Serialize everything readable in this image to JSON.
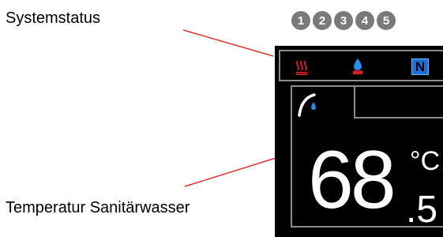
{
  "labels": {
    "system_status": "Systemstatus",
    "hot_water_temperature": "Temperatur Sanitärwasser"
  },
  "steps": [
    "1",
    "2",
    "3",
    "4",
    "5"
  ],
  "status_icons": [
    "heating-icon",
    "water-drop-flame-icon",
    "n-badge-icon"
  ],
  "status_badge": "N",
  "tab_icon": "tap-icon",
  "temperature": {
    "whole": "68",
    "decimal": ".5",
    "unit": "°C"
  },
  "colors": {
    "panel_background": "#000000",
    "frame": "#8c8c8c",
    "heating": "#e02020",
    "drop": "#2a8cf0",
    "badge": "#1f6fd6",
    "step": "#7a7a7a",
    "leader_line": "#e03030"
  }
}
